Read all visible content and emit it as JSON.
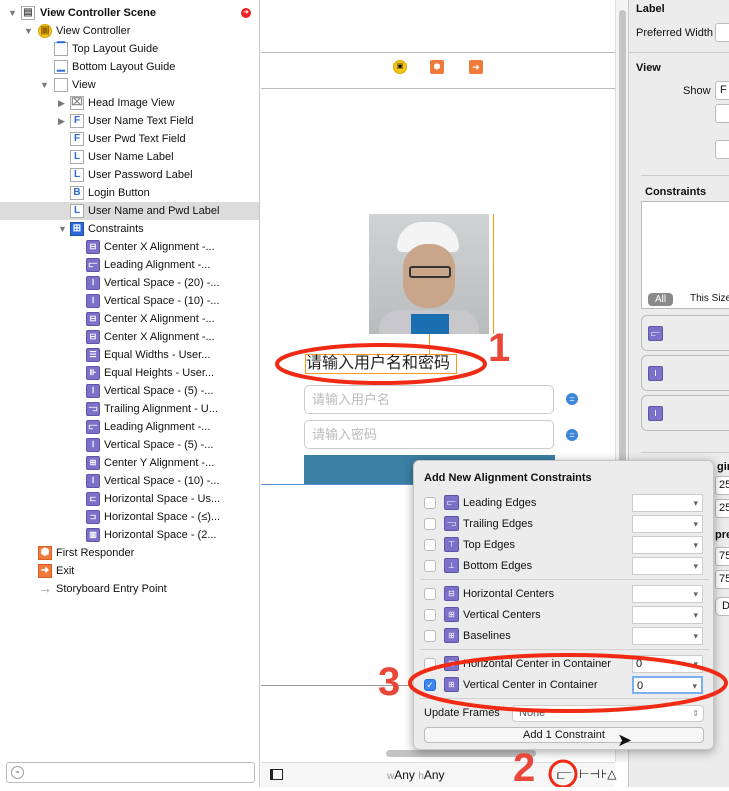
{
  "outline": {
    "scene": "View Controller Scene",
    "items": [
      {
        "label": "View Controller",
        "icon": "view-controller-icon"
      },
      {
        "label": "Top Layout Guide",
        "icon": "top-layout-guide-icon"
      },
      {
        "label": "Bottom Layout Guide",
        "icon": "bottom-layout-guide-icon"
      },
      {
        "label": "View",
        "icon": "view-icon"
      },
      {
        "label": "Head Image View",
        "icon": "image-view-icon"
      },
      {
        "label": "User Name Text Field",
        "icon": "F"
      },
      {
        "label": "User Pwd Text Field",
        "icon": "F"
      },
      {
        "label": "User Name Label",
        "icon": "L"
      },
      {
        "label": "User Password Label",
        "icon": "L"
      },
      {
        "label": "Login Button",
        "icon": "B"
      },
      {
        "label": "User Name and Pwd Label",
        "icon": "L"
      },
      {
        "label": "Constraints",
        "icon": "constraints-icon"
      }
    ],
    "constraints": [
      "Center X Alignment -...",
      "Leading Alignment -...",
      "Vertical Space - (20) -...",
      "Vertical Space - (10) -...",
      "Center X Alignment -...",
      "Center X Alignment -...",
      "Equal Widths - User...",
      "Equal Heights - User...",
      "Vertical Space - (5) -...",
      "Trailing Alignment - U...",
      "Leading Alignment -...",
      "Vertical Space - (5) -...",
      "Center Y Alignment -...",
      "Vertical Space - (10) -...",
      "Horizontal Space - Us...",
      "Horizontal Space - (≤)...",
      "Horizontal Space - (2..."
    ],
    "footer": [
      "First Responder",
      "Exit",
      "Storyboard Entry Point"
    ]
  },
  "canvas": {
    "label_text": "请输入用户名和密码",
    "username_placeholder": "请输入用户名",
    "password_placeholder": "请输入密码",
    "size_w": "w",
    "size_w_val": "Any",
    "size_h": "h",
    "size_h_val": "Any",
    "login_button_color": "#3b7fa3"
  },
  "popover": {
    "title": "Add New Alignment Constraints",
    "rows": [
      {
        "label": "Leading Edges",
        "checked": false,
        "value": ""
      },
      {
        "label": "Trailing Edges",
        "checked": false,
        "value": ""
      },
      {
        "label": "Top Edges",
        "checked": false,
        "value": ""
      },
      {
        "label": "Bottom Edges",
        "checked": false,
        "value": ""
      },
      {
        "label": "Horizontal Centers",
        "checked": false,
        "value": ""
      },
      {
        "label": "Vertical Centers",
        "checked": false,
        "value": ""
      },
      {
        "label": "Baselines",
        "checked": false,
        "value": ""
      },
      {
        "label": "Horizontal Center in Container",
        "checked": false,
        "value": "0"
      },
      {
        "label": "Vertical Center in Container",
        "checked": true,
        "value": "0"
      }
    ],
    "update_frames_label": "Update Frames",
    "update_frames_value": "None",
    "add_button": "Add 1 Constraint"
  },
  "inspector": {
    "label_section": "Label",
    "preferred_width": "Preferred Width",
    "view_section": "View",
    "show": "Show",
    "show_value": "F",
    "constraints": "Constraints",
    "all": "All",
    "this_size": "This Size",
    "hugging": "ging",
    "hug1": "25",
    "hug2": "25",
    "compression": "pre",
    "comp1": "75",
    "comp2": "75",
    "d": "D"
  },
  "annotations": {
    "one": "1",
    "two": "2",
    "three": "3",
    "color": "#e8473a"
  }
}
